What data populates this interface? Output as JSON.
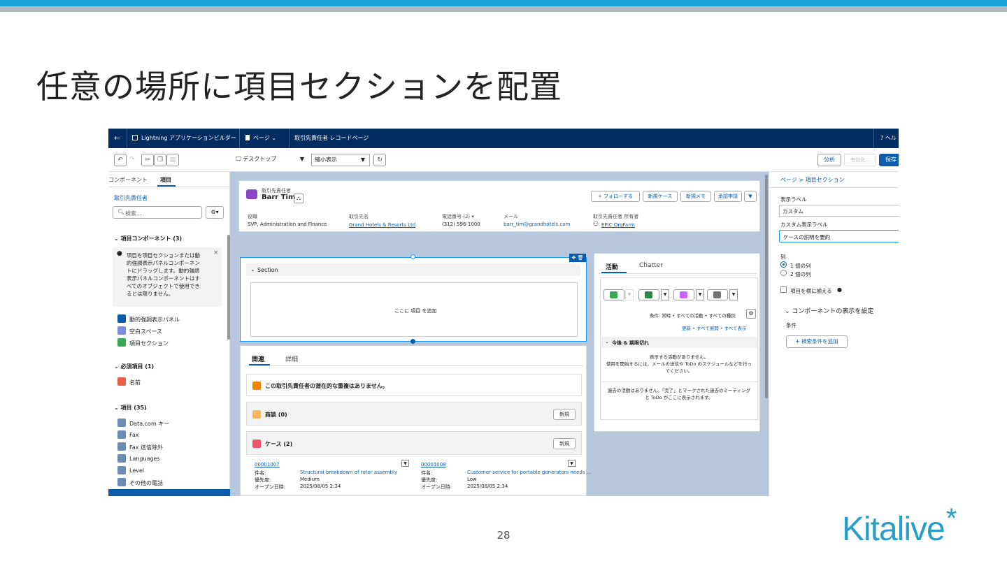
{
  "slide": {
    "title": "任意の場所に項目セクションを配置",
    "page_number": "28",
    "logo_text": "Kitalive",
    "logo_star": "*",
    "colors": {
      "top_band": "#1aa3d6",
      "gray_band": "#b0b8bf",
      "logo": "#2a9dc8"
    }
  },
  "app": {
    "nav": {
      "back_icon": "←",
      "app_name": "Lightning アプリケーションビルダー",
      "page_menu": "ページ",
      "page_title": "取引先責任者 レコードページ",
      "help": "? ヘル"
    },
    "toolbar": {
      "device": "デスクトップ",
      "view": "縮小表示",
      "analyze": "分析",
      "activate": "有効化...",
      "save": "保存"
    },
    "left_panel": {
      "tabs": [
        "コンポーネント",
        "項目"
      ],
      "object_label": "取引先責任者",
      "search_placeholder": "検索...",
      "sections": {
        "field_components": "項目コンポーネント (3)",
        "required": "必須項目 (1)",
        "fields": "項目 (35)"
      },
      "info_text": [
        "項目を項目セクションまたは動",
        "的強調表示パネルコンポーネン",
        "トにドラッグします。動的強調",
        "表示パネルコンポーネントはす",
        "べてのオブジェクトで使用でき",
        "るとは限りません。"
      ],
      "components": [
        "動的強調表示パネル",
        "空白スペース",
        "項目セクション"
      ],
      "required_fields": [
        "名前"
      ],
      "field_list": [
        "Data.com キー",
        "Fax",
        "Fax 送信除外",
        "Languages",
        "Level",
        "その他の電話"
      ]
    },
    "record": {
      "object_type": "取引先責任者",
      "name": "Barr Tim",
      "actions": [
        "+ フォローする",
        "新規ケース",
        "新規メモ",
        "承認申請"
      ],
      "fields": [
        {
          "label": "役職",
          "value": "SVP, Administration and Finance"
        },
        {
          "label": "取引先名",
          "value": "Grand Hotels & Resorts Ltd"
        },
        {
          "label": "電話番号 (2) ▾",
          "value": "(312) 596-1000"
        },
        {
          "label": "メール",
          "value": "barr_tim@grandhotels.com"
        },
        {
          "label": "取引先責任者 所有者",
          "value": "EPIC OrgFarm"
        }
      ]
    },
    "section": {
      "title": "Section",
      "drop_text": "ここに 項目 を追加"
    },
    "related": {
      "tabs": [
        "関連",
        "詳細"
      ],
      "duplicate_msg": "この取引先責任者の潜在的な重複はありません。",
      "opportunities": "商談 (0)",
      "cases": "ケース (2)",
      "new_button": "新規",
      "case_items": [
        {
          "number": "00001007",
          "subject_label": "件名:",
          "subject": "Structural breakdown of rotor assembly",
          "priority_label": "優先度:",
          "priority": "Medium",
          "opened_label": "オープン日時:",
          "opened": "2025/08/05 2:34"
        },
        {
          "number": "00001008",
          "subject_label": "件名:",
          "subject": "Customer service for portable generators needs ...",
          "priority_label": "優先度:",
          "priority": "Low",
          "opened_label": "オープン日時:",
          "opened": "2025/08/05 2:34"
        }
      ]
    },
    "activity": {
      "tabs": [
        "活動",
        "Chatter"
      ],
      "filter_text": "条件: 常時 • すべての活動 • すべての種別",
      "links": "更新 • すべて展開 • すべて表示",
      "upcoming_header": "今後 & 期限切れ",
      "no_activity": [
        "表示する活動がありません。",
        "使用を開始するには、メールの送信や ToDo のスケジュールなどを行っ",
        "てください。"
      ],
      "past_activity": [
        "過去の活動はありません。「完了」とマークされた過去のミーティング",
        "と ToDo がここに表示されます。"
      ]
    },
    "right_panel": {
      "breadcrumb": "ページ > 項目セクション",
      "display_label_label": "表示ラベル",
      "display_label_value": "カスタム",
      "custom_label_label": "カスタム表示ラベル",
      "custom_label_value": "ケースの説明を要約",
      "columns_label": "列",
      "column_options": [
        "1 個の列",
        "2 個の列"
      ],
      "align_fields": "項目を横に揃える",
      "visibility_header": "コンポーネントの表示を設定",
      "conditions_label": "条件",
      "add_filter": "+ 検索条件を追加"
    }
  }
}
